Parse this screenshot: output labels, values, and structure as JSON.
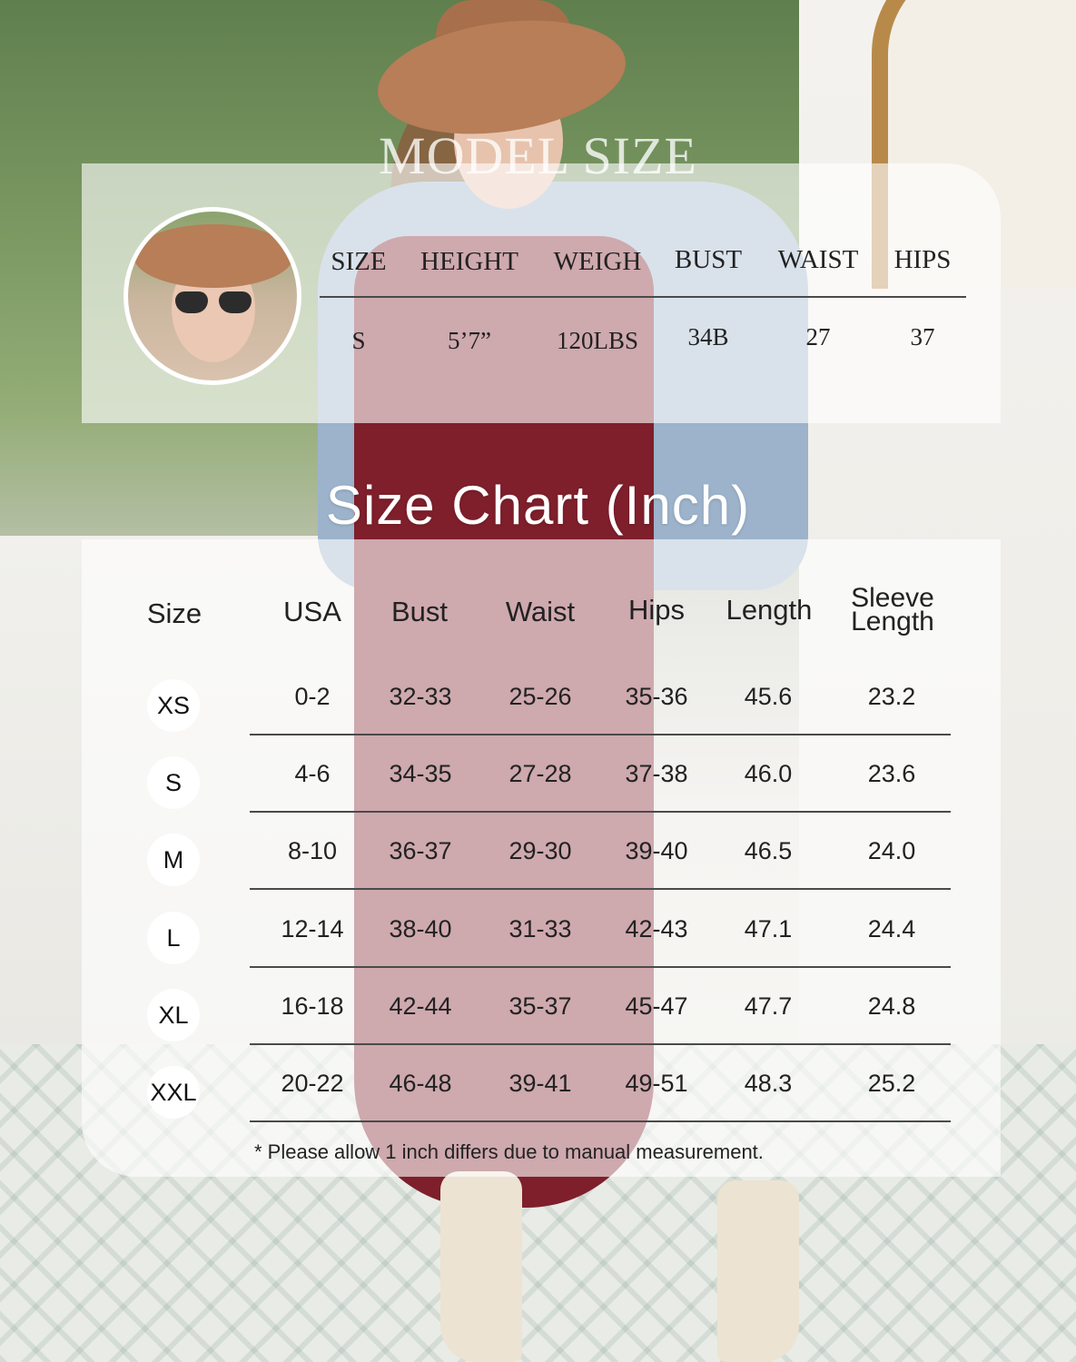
{
  "model_size": {
    "title": "MODEL SIZE",
    "headers": [
      "SIZE",
      "HEIGHT",
      "WEIGH",
      "BUST",
      "WAIST",
      "HIPS"
    ],
    "values": [
      "S",
      "5’7”",
      "120LBS",
      "34B",
      "27",
      "37"
    ]
  },
  "size_chart": {
    "title": "Size Chart (Inch)",
    "headers": [
      "Size",
      "USA",
      "Bust",
      "Waist",
      "Hips",
      "Length",
      "Sleeve Length"
    ],
    "rows": [
      [
        "XS",
        "0-2",
        "32-33",
        "25-26",
        "35-36",
        "45.6",
        "23.2"
      ],
      [
        "S",
        "4-6",
        "34-35",
        "27-28",
        "37-38",
        "46.0",
        "23.6"
      ],
      [
        "M",
        "8-10",
        "36-37",
        "29-30",
        "39-40",
        "46.5",
        "24.0"
      ],
      [
        "L",
        "12-14",
        "38-40",
        "31-33",
        "42-43",
        "47.1",
        "24.4"
      ],
      [
        "XL",
        "16-18",
        "42-44",
        "35-37",
        "45-47",
        "47.7",
        "24.8"
      ],
      [
        "XXL",
        "20-22",
        "46-48",
        "39-41",
        "49-51",
        "48.3",
        "25.2"
      ]
    ],
    "note": "* Please allow 1 inch differs due to manual measurement."
  }
}
